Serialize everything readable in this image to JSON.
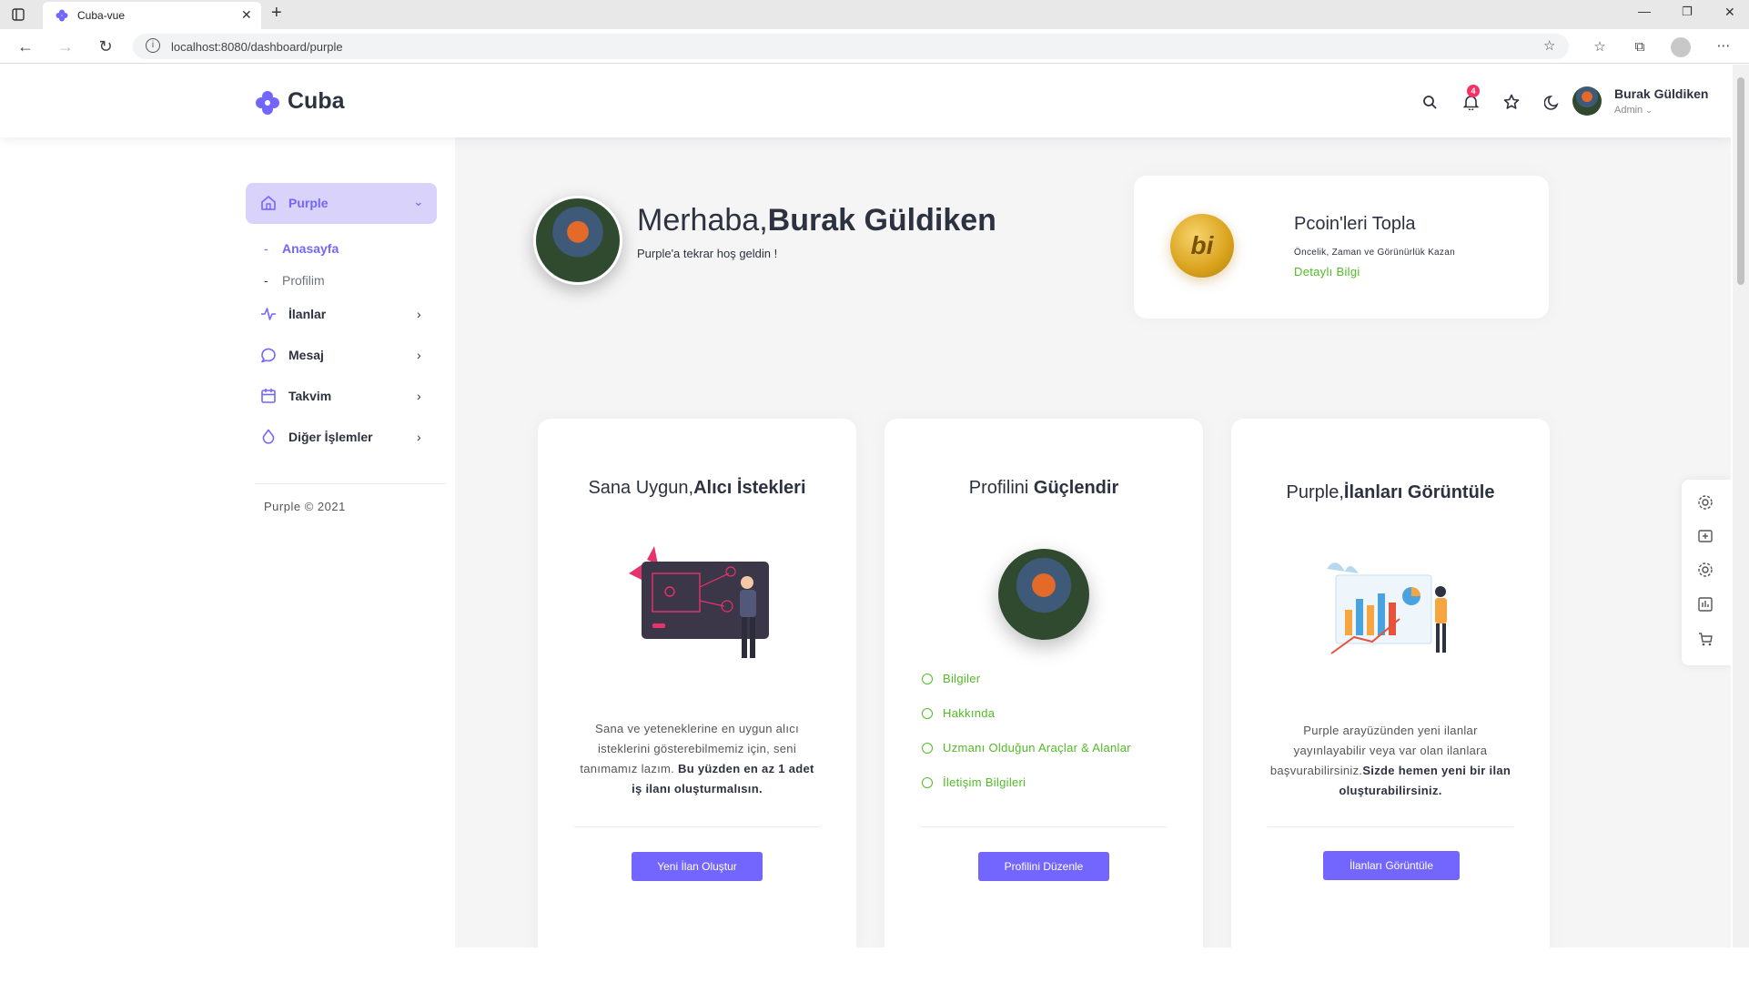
{
  "browser": {
    "tab_title": "Cuba-vue",
    "url": "localhost:8080/dashboard/purple"
  },
  "header": {
    "logo": "Cuba",
    "user_name": "Burak Güldiken",
    "user_role": "Admin",
    "notification_count": "4"
  },
  "sidebar": {
    "active_item": "Purple",
    "sub_items": [
      "Anasayfa",
      "Profilim"
    ],
    "items": [
      {
        "label": "İlanlar",
        "icon": "activity-icon"
      },
      {
        "label": "Mesaj",
        "icon": "message-icon"
      },
      {
        "label": "Takvim",
        "icon": "calendar-icon"
      },
      {
        "label": "Diğer İşlemler",
        "icon": "droplet-icon"
      }
    ],
    "footer": "Purple © 2021"
  },
  "welcome": {
    "greeting": "Merhaba,",
    "name": "Burak Güldiken",
    "subtitle": "Purple'a tekrar hoş geldin !"
  },
  "pcoin": {
    "badge": "bi",
    "title": "Pcoin'leri Topla",
    "subtitle": "Öncelik, Zaman ve Görünürlük Kazan",
    "link": "Detaylı Bilgi"
  },
  "cards": [
    {
      "title_light": "Sana Uygun,",
      "title_bold": "Alıcı İstekleri",
      "text_plain": "Sana ve yeteneklerine en uygun alıcı isteklerini gösterebilmemiz için, seni tanımamız lazım. ",
      "text_bold": "Bu yüzden en az 1 adet iş ilanı oluşturmalısın.",
      "button": "Yeni İlan Oluştur"
    },
    {
      "title_light": "Profilini ",
      "title_bold": "Güçlendir",
      "checklist": [
        "Bilgiler",
        "Hakkında",
        "Uzmanı Olduğun Araçlar & Alanlar",
        "İletişim Bilgileri"
      ],
      "button": "Profilini Düzenle"
    },
    {
      "title_light": "Purple,",
      "title_bold": "İlanları Görüntüle",
      "text_plain": "Purple arayüzünden yeni ilanlar yayınlayabilir veya var olan ilanlara başvurabilirsiniz.",
      "text_bold": "Sizde hemen yeni bir ilan oluşturabilirsiniz.",
      "button": "İlanları Görüntüle"
    }
  ],
  "colors": {
    "primary": "#7366ff",
    "success": "#51bb25",
    "danger": "#f73164",
    "dark": "#2c323f"
  }
}
